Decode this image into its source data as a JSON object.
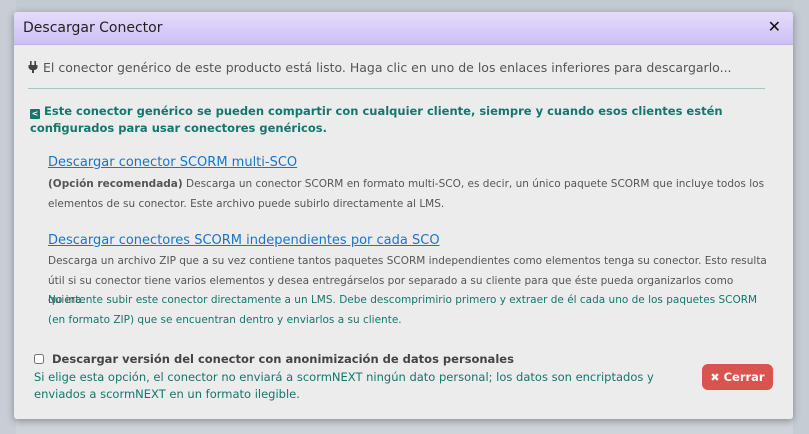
{
  "dialog": {
    "title": "Descargar Conector",
    "close_glyph": "✕"
  },
  "intro": {
    "icon": "plug-icon",
    "text": "El conector genérico de este producto está listo. Haga clic en uno de los enlaces inferiores para descargarlo..."
  },
  "share_notice": {
    "icon": "share-icon",
    "text": "Este conector genérico se pueden compartir con cualquier cliente, siempre y cuando esos clientes estén configurados para usar conectores genéricos."
  },
  "option_multi": {
    "link": "Descargar conector SCORM multi-SCO",
    "recommended": "(Opción recomendada)",
    "description": "Descarga un conector SCORM en formato multi-SCO, es decir, un único paquete SCORM que incluye todos los elementos de su conector. Este archivo puede subirlo directamente al LMS."
  },
  "option_independent": {
    "link": "Descargar conectores SCORM independientes por cada SCO",
    "description": "Descarga un archivo ZIP que a su vez contiene tantos paquetes SCORM independientes como elementos tenga su conector. Esto resulta útil si su conector tiene varios elementos y desea entregárselos por separado a su cliente para que éste pueda organizarlos como quiera.",
    "warning": "No intente subir este conector directamente a un LMS. Debe descomprimirio primero y extraer de él cada uno de los paquetes SCORM (en formato ZIP) que se encuentran dentro y enviarlos a su cliente."
  },
  "anonymize": {
    "label": "Descargar versión del conector con anonimización de datos personales",
    "checked": false,
    "note": "Si elige esta opción, el conector no enviará a scormNEXT ningún dato personal; los datos son encriptados y enviados a scormNEXT en un formato ilegible."
  },
  "buttons": {
    "close_label": "Cerrar"
  },
  "colors": {
    "title_gradient_top": "#e4dcfb",
    "title_gradient_bottom": "#cdbff6",
    "link": "#1b74c8",
    "notice_teal": "#14766c",
    "close_button": "#d9534f"
  }
}
